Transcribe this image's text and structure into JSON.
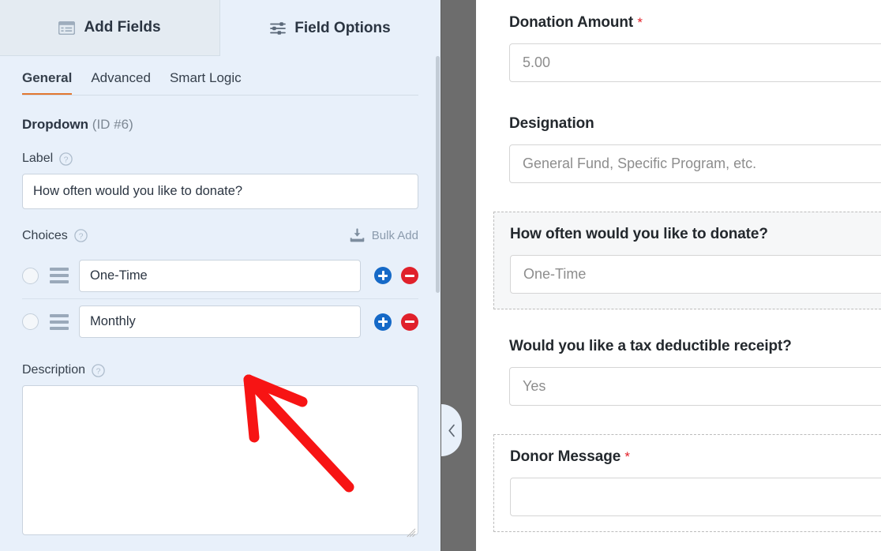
{
  "builder": {
    "tabs": [
      {
        "label": "Add Fields",
        "icon": "fields-list-icon",
        "active": false
      },
      {
        "label": "Field Options",
        "icon": "sliders-icon",
        "active": true
      }
    ],
    "sub_tabs": [
      {
        "label": "General",
        "active": true
      },
      {
        "label": "Advanced",
        "active": false
      },
      {
        "label": "Smart Logic",
        "active": false
      }
    ],
    "field_heading": {
      "type": "Dropdown",
      "id": "(ID #6)"
    },
    "label_setting": {
      "caption": "Label",
      "help_icon": "help-circle-icon",
      "value": "How often would you like to donate?"
    },
    "choices_setting": {
      "caption": "Choices",
      "help_icon": "help-circle-icon",
      "bulk_add_label": "Bulk Add",
      "bulk_add_icon": "import-download-icon",
      "items": [
        {
          "value": "One-Time",
          "selected": false
        },
        {
          "value": "Monthly",
          "selected": false
        }
      ],
      "add_icon": "plus-circle-icon",
      "delete_icon": "minus-circle-icon",
      "drag_icon": "drag-handle-icon",
      "radio_icon": "radio-button-icon"
    },
    "description_setting": {
      "caption": "Description",
      "help_icon": "help-circle-icon",
      "value": "",
      "placeholder": ""
    },
    "collapse_handle_icon": "chevron-left-icon"
  },
  "preview": {
    "fields": [
      {
        "label": "Donation Amount",
        "required": true,
        "required_mark": "*",
        "value": "5.00",
        "state": "normal"
      },
      {
        "label": "Designation",
        "required": false,
        "required_mark": "",
        "value": "General Fund, Specific Program, etc.",
        "state": "normal"
      },
      {
        "label": "How often would you like to donate?",
        "required": false,
        "required_mark": "",
        "value": "One-Time",
        "state": "active"
      },
      {
        "label": "Would you like a tax deductible receipt?",
        "required": false,
        "required_mark": "",
        "value": "Yes",
        "state": "normal"
      },
      {
        "label": "Donor Message",
        "required": true,
        "required_mark": "*",
        "value": "",
        "state": "hovered"
      }
    ]
  },
  "annotation": {
    "type": "arrow",
    "color": "#f71414",
    "points_to": "monthly-choice-input"
  },
  "colors": {
    "panel_bg": "#e8f0fa",
    "tab_inactive_bg": "#e4ebf2",
    "accent_orange": "#e27730",
    "divider_strip": "#6d6d6d",
    "add_button": "#1569c7",
    "delete_button": "#e0212b",
    "required_red": "#e22028",
    "annotation_red": "#f71414"
  }
}
